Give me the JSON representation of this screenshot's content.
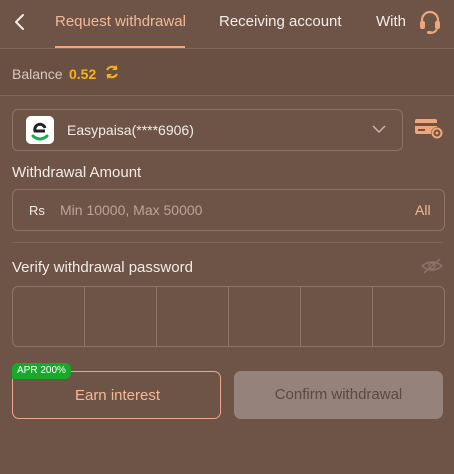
{
  "tabs": [
    {
      "label": "Request withdrawal"
    },
    {
      "label": "Receiving account"
    },
    {
      "label": "With"
    }
  ],
  "balance": {
    "label": "Balance",
    "value": "0.52"
  },
  "method": {
    "name": "Easypaisa(****6906)"
  },
  "amount": {
    "label": "Withdrawal Amount",
    "currency": "Rs",
    "placeholder": "Min 10000, Max 50000",
    "all_label": "All"
  },
  "password": {
    "label": "Verify withdrawal password"
  },
  "actions": {
    "apr_badge": "APR 200%",
    "earn_label": "Earn interest",
    "confirm_label": "Confirm withdrawal"
  },
  "colors": {
    "background": "#6e5446",
    "accent": "#f0a57b",
    "balance": "#f7b21b",
    "apr_badge": "#17a928"
  }
}
